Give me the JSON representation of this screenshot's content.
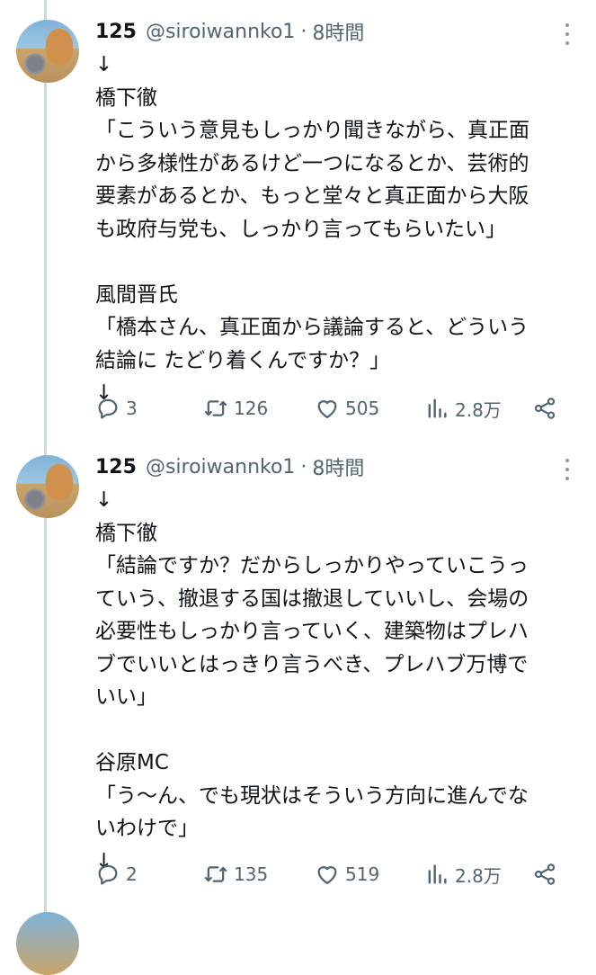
{
  "tweets": [
    {
      "name": "125",
      "handle": "@siroiwannko1",
      "separator": "·",
      "time": "8時間",
      "body": "↓\n橋下徹\n「こういう意見もしっかり聞きながら、真正面\nから多様性があるけど一つになるとか、芸術的\n要素があるとか、もっと堂々と真正面から大阪\nも政府与党も、しっかり言ってもらいたい」\n\n風間晋氏\n「橋本さん、真正面から議論すると、どういう\n結論に たどり着くんですか？」\n↓",
      "replies": "3",
      "retweets": "126",
      "likes": "505",
      "views": "2.8万"
    },
    {
      "name": "125",
      "handle": "@siroiwannko1",
      "separator": "·",
      "time": "8時間",
      "body": "↓\n橋下徹\n「結論ですか？だからしっかりやっていこうっ\nていう、撤退する国は撤退していいし、会場の\n必要性もしっかり言っていく、建築物はプレハ\nブでいいとはっきり言うべき、プレハブ万博で\nいい」\n\n谷原MC\n「う〜ん、でも現状はそういう方向に進んでな\nいわけで」\n↓",
      "replies": "2",
      "retweets": "135",
      "likes": "519",
      "views": "2.8万"
    }
  ],
  "icons": {
    "reply": "reply-icon",
    "retweet": "retweet-icon",
    "like": "heart-icon",
    "views": "views-icon",
    "share": "share-icon",
    "more": "more-icon"
  },
  "colors": {
    "text": "#0f1419",
    "secondary": "#536471",
    "thread_line": "#cfd9de"
  }
}
